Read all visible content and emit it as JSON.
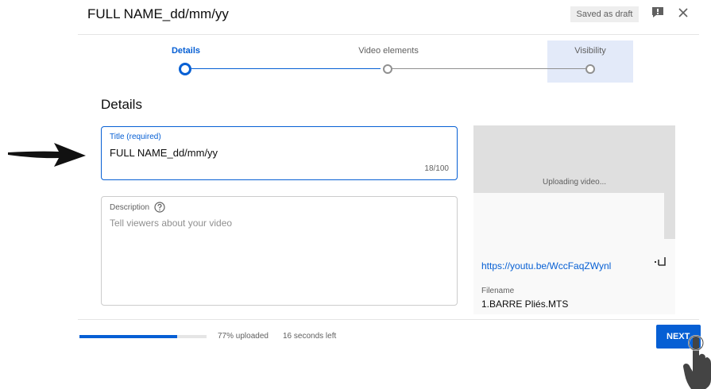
{
  "header": {
    "title": "FULL NAME_dd/mm/yy",
    "draft_status": "Saved as draft"
  },
  "steps": [
    {
      "label": "Details",
      "state": "active"
    },
    {
      "label": "Video elements",
      "state": "pending"
    },
    {
      "label": "Visibility",
      "state": "pending"
    }
  ],
  "section_title": "Details",
  "title_field": {
    "label": "Title (required)",
    "value": "FULL NAME_dd/mm/yy",
    "char_count": "18/100"
  },
  "description_field": {
    "label": "Description",
    "placeholder": "Tell viewers about your video"
  },
  "preview": {
    "status": "Uploading video...",
    "link": "https://youtu.be/WccFaqZWynl",
    "filename_label": "Filename",
    "filename": "1.BARRE Pliés.MTS"
  },
  "footer": {
    "upload_percent": 77,
    "progress_text": "77% uploaded",
    "time_left": "16 seconds left",
    "next_label": "NEXT"
  },
  "colors": {
    "accent": "#065fd4",
    "step_highlight": "#e3eaf9"
  },
  "icons": [
    "feedback-icon",
    "close-icon",
    "help-icon",
    "copy-link-icon",
    "arrow-pointer-icon",
    "hand-pointer-icon"
  ]
}
